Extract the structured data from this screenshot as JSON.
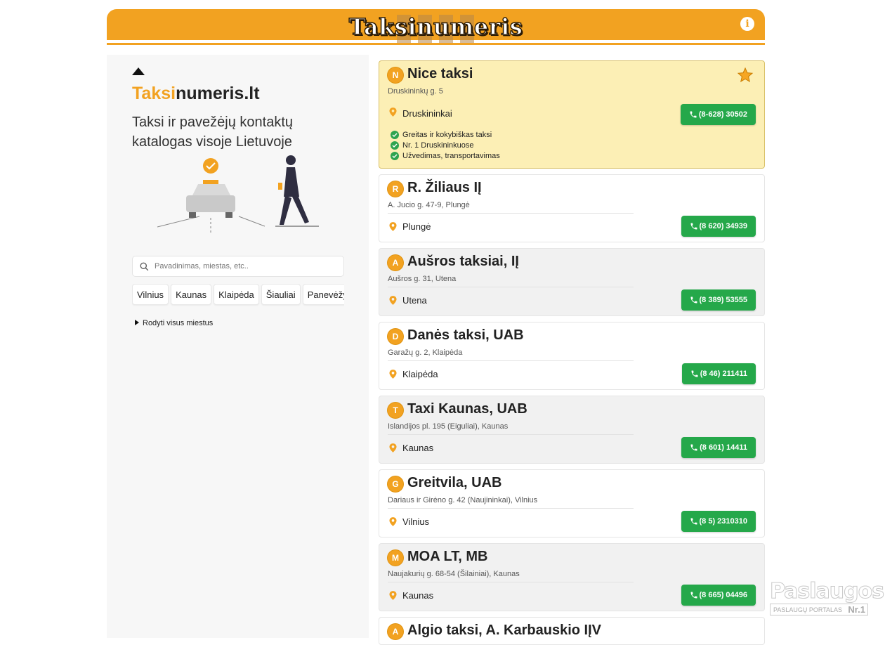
{
  "header": {
    "logo_text": "Taksinumeris",
    "info_icon": "info-icon",
    "brand_color": "#f2a221"
  },
  "sidebar": {
    "brand_accent": "Taksi",
    "brand_rest": "numeris.lt",
    "tagline": "Taksi ir pavežėjų kontaktų katalogas visoje Lietuvoje",
    "search": {
      "placeholder": "Pavadinimas, miestas, etc.."
    },
    "cities": [
      "Vilnius",
      "Kaunas",
      "Klaipėda",
      "Šiauliai",
      "Panevėžys"
    ],
    "show_all": "Rodyti visus miestus"
  },
  "listings": [
    {
      "letter": "N",
      "name": "Nice taksi",
      "address": "Druskininkų g. 5",
      "city": "Druskininkai",
      "phone": "(8-628) 30502",
      "featured": true,
      "features": [
        "Greitas ir kokybiškas taksi",
        "Nr. 1 Druskininkuose",
        "Užvedimas, transportavimas"
      ]
    },
    {
      "letter": "R",
      "name": "R. Žiliaus IĮ",
      "address": "A. Jucio g. 47-9, Plungė",
      "city": "Plungė",
      "phone": "(8 620) 34939"
    },
    {
      "letter": "A",
      "name": "Aušros taksiai, IĮ",
      "address": "Aušros g. 31, Utena",
      "city": "Utena",
      "phone": "(8 389) 53555"
    },
    {
      "letter": "D",
      "name": "Danės taksi, UAB",
      "address": "Garažų g. 2, Klaipėda",
      "city": "Klaipėda",
      "phone": "(8 46) 211411"
    },
    {
      "letter": "T",
      "name": "Taxi Kaunas, UAB",
      "address": "Islandijos pl. 195 (Eiguliai), Kaunas",
      "city": "Kaunas",
      "phone": "(8 601) 14411"
    },
    {
      "letter": "G",
      "name": "Greitvila, UAB",
      "address": "Dariaus ir Girėno g. 42 (Naujininkai), Vilnius",
      "city": "Vilnius",
      "phone": "(8 5) 2310310"
    },
    {
      "letter": "M",
      "name": "MOA LT, MB",
      "address": "Naujakurių g. 68-54 (Šilainiai), Kaunas",
      "city": "Kaunas",
      "phone": "(8 665) 04496"
    },
    {
      "letter": "A",
      "name": "Algio taksi, A. Karbauskio IĮV"
    }
  ],
  "watermark": {
    "title": "Paslaugos.lt",
    "subtitle": "PASLAUGŲ PORTALAS",
    "badge": "Nr.1"
  }
}
